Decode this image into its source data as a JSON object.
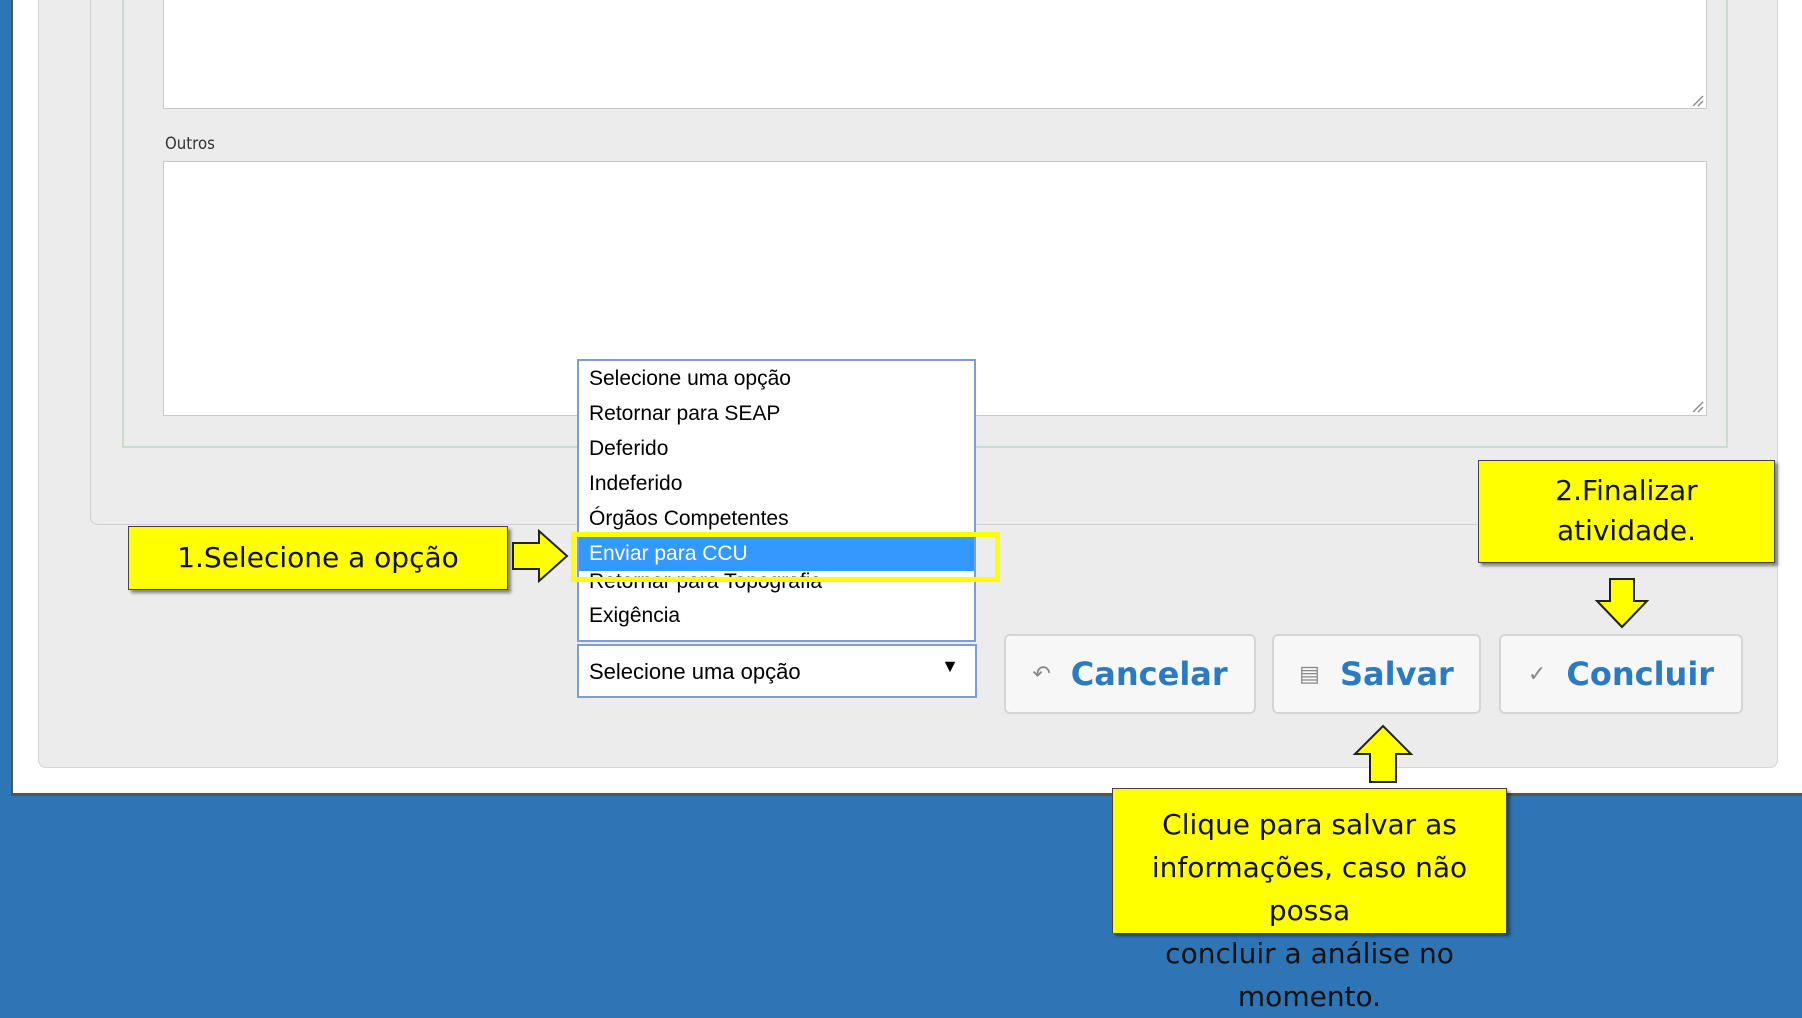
{
  "form": {
    "outros_label": "Outros"
  },
  "dropdown": {
    "options": [
      "Selecione uma opção",
      "Retornar para SEAP",
      "Deferido",
      "Indeferido",
      "Órgãos Competentes",
      "Enviar para CCU",
      "Retornar para Topografia",
      "Exigência"
    ],
    "highlighted": "Enviar para CCU",
    "selected_value": "Selecione uma opção",
    "arrow_glyph": "▼"
  },
  "buttons": {
    "cancel_label": "Cancelar",
    "cancel_icon": "↶",
    "save_label": "Salvar",
    "save_icon": "▤",
    "conclude_label": "Concluir",
    "conclude_icon": "✓"
  },
  "callouts": {
    "step1": "1.Selecione a opção",
    "step2_line1": "2.Finalizar",
    "step2_line2": "atividade.",
    "save_line1": "Clique para salvar as",
    "save_line2": "informações, caso não possa",
    "save_line3": "concluir a análise no momento."
  },
  "colors": {
    "background": "#2e75b6",
    "callout": "#ffff00",
    "button_text": "#2b7bc2",
    "selection": "#3399ff"
  }
}
